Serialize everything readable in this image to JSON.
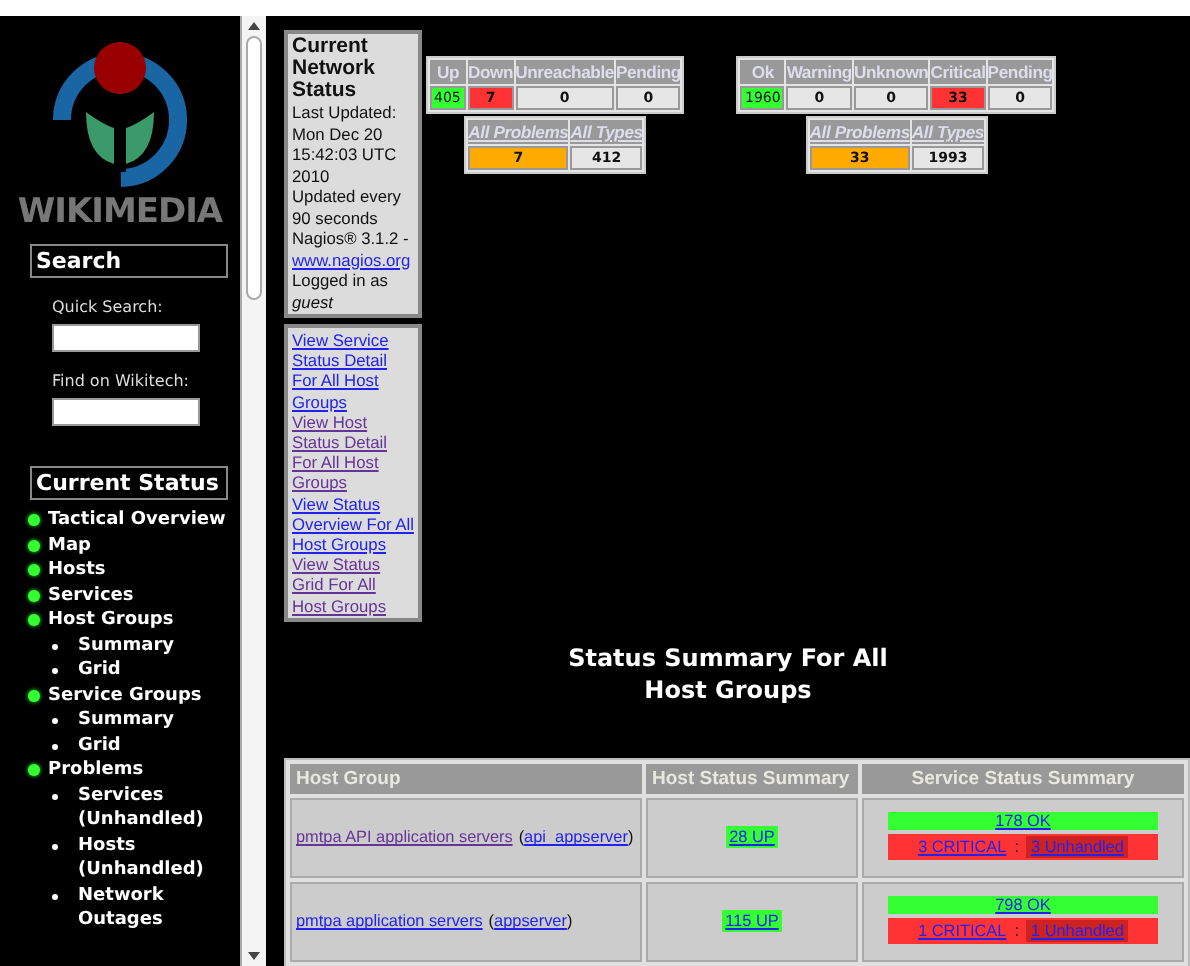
{
  "sidebar": {
    "logo_text": "WIKIMEDIA",
    "search": {
      "title": "Search",
      "fields": [
        {
          "label": "Quick Search:"
        },
        {
          "label": "Find on Wikitech:"
        }
      ]
    },
    "current_status": {
      "title": "Current Status",
      "items": [
        {
          "label": "Tactical Overview"
        },
        {
          "label": "Map"
        },
        {
          "label": "Hosts"
        },
        {
          "label": "Services"
        },
        {
          "label": "Host Groups",
          "children": [
            {
              "label": "Summary"
            },
            {
              "label": "Grid"
            }
          ]
        },
        {
          "label": "Service Groups",
          "children": [
            {
              "label": "Summary"
            },
            {
              "label": "Grid"
            }
          ]
        },
        {
          "label": "Problems",
          "children": [
            {
              "label": "Services (Unhandled)"
            },
            {
              "label": "Hosts (Unhandled)"
            },
            {
              "label": "Network Outages"
            }
          ]
        }
      ]
    }
  },
  "info": {
    "title": "Current Network Status",
    "lines": [
      "Last Updated: Mon Dec 20 15:42:03 UTC 2010",
      "Updated every 90 seconds",
      "Nagios® 3.1.2 -"
    ],
    "link": "www.nagios.org",
    "logged_in": "Logged in as",
    "user": "guest"
  },
  "links": [
    {
      "label": "View Service Status Detail For All Host Groups",
      "visited": false
    },
    {
      "label": "View Host Status Detail For All Host Groups",
      "visited": true
    },
    {
      "label": "View Status Overview For All Host Groups",
      "visited": false
    },
    {
      "label": "View Status Grid For All Host Groups",
      "visited": true
    }
  ],
  "host_totals": {
    "columns": [
      {
        "label": "Up",
        "value": "405",
        "kind": "ok"
      },
      {
        "label": "Down",
        "value": "7",
        "kind": "bad"
      },
      {
        "label": "Unreachable",
        "value": "0",
        "kind": "none"
      },
      {
        "label": "Pending",
        "value": "0",
        "kind": "none"
      }
    ],
    "summary": [
      {
        "label": "All Problems",
        "value": "7",
        "kind": "warn"
      },
      {
        "label": "All Types",
        "value": "412",
        "kind": "none"
      }
    ]
  },
  "service_totals": {
    "columns": [
      {
        "label": "Ok",
        "value": "1960",
        "kind": "ok"
      },
      {
        "label": "Warning",
        "value": "0",
        "kind": "none"
      },
      {
        "label": "Unknown",
        "value": "0",
        "kind": "none"
      },
      {
        "label": "Critical",
        "value": "33",
        "kind": "bad"
      },
      {
        "label": "Pending",
        "value": "0",
        "kind": "none"
      }
    ],
    "summary": [
      {
        "label": "All Problems",
        "value": "33",
        "kind": "warn"
      },
      {
        "label": "All Types",
        "value": "1993",
        "kind": "none"
      }
    ]
  },
  "heading": "Status Summary For All Host Groups",
  "table": {
    "columns": [
      "Host Group",
      "Host Status Summary",
      "Service Status Summary"
    ],
    "rows": [
      {
        "group": "pmtpa API application servers",
        "group_visited": true,
        "alias_open": "(",
        "alias": "api_appserver",
        "alias_close": ")",
        "separator": ":",
        "host_status": "28 UP",
        "ok": "178 OK",
        "critical": "3 CRITICAL",
        "unhandled": "3 Unhandled"
      },
      {
        "group": "pmtpa application servers",
        "group_visited": false,
        "alias_open": "(",
        "alias": "appserver",
        "alias_close": ")",
        "separator": ":",
        "host_status": "115 UP",
        "ok": "798 OK",
        "critical": "1 CRITICAL",
        "unhandled": "1 Unhandled"
      }
    ]
  }
}
